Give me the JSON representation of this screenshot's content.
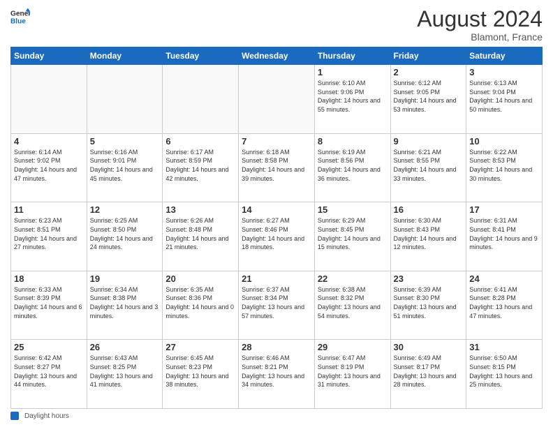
{
  "header": {
    "logo_line1": "General",
    "logo_line2": "Blue",
    "month_year": "August 2024",
    "location": "Blamont, France"
  },
  "days_of_week": [
    "Sunday",
    "Monday",
    "Tuesday",
    "Wednesday",
    "Thursday",
    "Friday",
    "Saturday"
  ],
  "weeks": [
    [
      {
        "day": null
      },
      {
        "day": null
      },
      {
        "day": null
      },
      {
        "day": null
      },
      {
        "day": 1,
        "sunrise": "6:10 AM",
        "sunset": "9:06 PM",
        "daylight": "14 hours and 55 minutes."
      },
      {
        "day": 2,
        "sunrise": "6:12 AM",
        "sunset": "9:05 PM",
        "daylight": "14 hours and 53 minutes."
      },
      {
        "day": 3,
        "sunrise": "6:13 AM",
        "sunset": "9:04 PM",
        "daylight": "14 hours and 50 minutes."
      }
    ],
    [
      {
        "day": 4,
        "sunrise": "6:14 AM",
        "sunset": "9:02 PM",
        "daylight": "14 hours and 47 minutes."
      },
      {
        "day": 5,
        "sunrise": "6:16 AM",
        "sunset": "9:01 PM",
        "daylight": "14 hours and 45 minutes."
      },
      {
        "day": 6,
        "sunrise": "6:17 AM",
        "sunset": "8:59 PM",
        "daylight": "14 hours and 42 minutes."
      },
      {
        "day": 7,
        "sunrise": "6:18 AM",
        "sunset": "8:58 PM",
        "daylight": "14 hours and 39 minutes."
      },
      {
        "day": 8,
        "sunrise": "6:19 AM",
        "sunset": "8:56 PM",
        "daylight": "14 hours and 36 minutes."
      },
      {
        "day": 9,
        "sunrise": "6:21 AM",
        "sunset": "8:55 PM",
        "daylight": "14 hours and 33 minutes."
      },
      {
        "day": 10,
        "sunrise": "6:22 AM",
        "sunset": "8:53 PM",
        "daylight": "14 hours and 30 minutes."
      }
    ],
    [
      {
        "day": 11,
        "sunrise": "6:23 AM",
        "sunset": "8:51 PM",
        "daylight": "14 hours and 27 minutes."
      },
      {
        "day": 12,
        "sunrise": "6:25 AM",
        "sunset": "8:50 PM",
        "daylight": "14 hours and 24 minutes."
      },
      {
        "day": 13,
        "sunrise": "6:26 AM",
        "sunset": "8:48 PM",
        "daylight": "14 hours and 21 minutes."
      },
      {
        "day": 14,
        "sunrise": "6:27 AM",
        "sunset": "8:46 PM",
        "daylight": "14 hours and 18 minutes."
      },
      {
        "day": 15,
        "sunrise": "6:29 AM",
        "sunset": "8:45 PM",
        "daylight": "14 hours and 15 minutes."
      },
      {
        "day": 16,
        "sunrise": "6:30 AM",
        "sunset": "8:43 PM",
        "daylight": "14 hours and 12 minutes."
      },
      {
        "day": 17,
        "sunrise": "6:31 AM",
        "sunset": "8:41 PM",
        "daylight": "14 hours and 9 minutes."
      }
    ],
    [
      {
        "day": 18,
        "sunrise": "6:33 AM",
        "sunset": "8:39 PM",
        "daylight": "14 hours and 6 minutes."
      },
      {
        "day": 19,
        "sunrise": "6:34 AM",
        "sunset": "8:38 PM",
        "daylight": "14 hours and 3 minutes."
      },
      {
        "day": 20,
        "sunrise": "6:35 AM",
        "sunset": "8:36 PM",
        "daylight": "14 hours and 0 minutes."
      },
      {
        "day": 21,
        "sunrise": "6:37 AM",
        "sunset": "8:34 PM",
        "daylight": "13 hours and 57 minutes."
      },
      {
        "day": 22,
        "sunrise": "6:38 AM",
        "sunset": "8:32 PM",
        "daylight": "13 hours and 54 minutes."
      },
      {
        "day": 23,
        "sunrise": "6:39 AM",
        "sunset": "8:30 PM",
        "daylight": "13 hours and 51 minutes."
      },
      {
        "day": 24,
        "sunrise": "6:41 AM",
        "sunset": "8:28 PM",
        "daylight": "13 hours and 47 minutes."
      }
    ],
    [
      {
        "day": 25,
        "sunrise": "6:42 AM",
        "sunset": "8:27 PM",
        "daylight": "13 hours and 44 minutes."
      },
      {
        "day": 26,
        "sunrise": "6:43 AM",
        "sunset": "8:25 PM",
        "daylight": "13 hours and 41 minutes."
      },
      {
        "day": 27,
        "sunrise": "6:45 AM",
        "sunset": "8:23 PM",
        "daylight": "13 hours and 38 minutes."
      },
      {
        "day": 28,
        "sunrise": "6:46 AM",
        "sunset": "8:21 PM",
        "daylight": "13 hours and 34 minutes."
      },
      {
        "day": 29,
        "sunrise": "6:47 AM",
        "sunset": "8:19 PM",
        "daylight": "13 hours and 31 minutes."
      },
      {
        "day": 30,
        "sunrise": "6:49 AM",
        "sunset": "8:17 PM",
        "daylight": "13 hours and 28 minutes."
      },
      {
        "day": 31,
        "sunrise": "6:50 AM",
        "sunset": "8:15 PM",
        "daylight": "13 hours and 25 minutes."
      }
    ]
  ],
  "footer": {
    "label": "Daylight hours"
  }
}
